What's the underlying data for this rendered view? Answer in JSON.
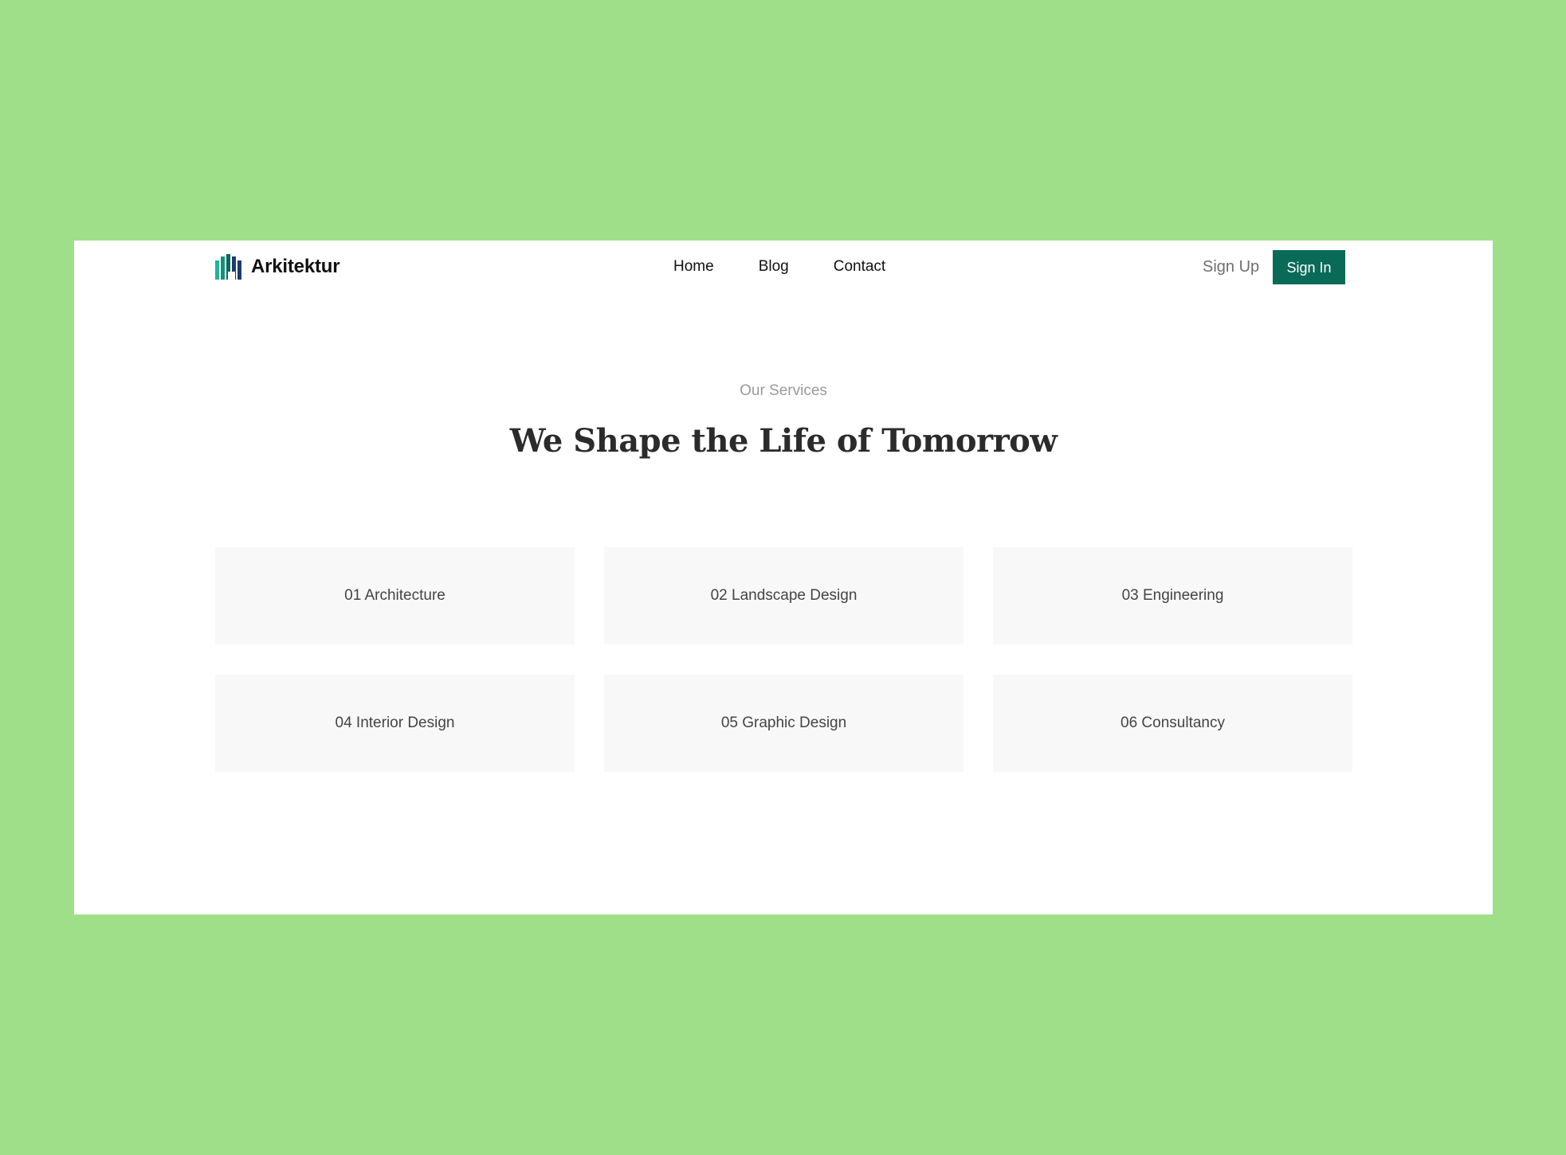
{
  "brand": {
    "name": "Arkitektur",
    "logo_icon": "building-bars-icon",
    "colors": [
      "#1fb59a",
      "#0a6a58",
      "#1b3b6f"
    ]
  },
  "nav": {
    "items": [
      {
        "label": "Home"
      },
      {
        "label": "Blog"
      },
      {
        "label": "Contact"
      }
    ]
  },
  "auth": {
    "sign_up_label": "Sign Up",
    "sign_in_label": "Sign In",
    "accent_color": "#0a6a58"
  },
  "services": {
    "eyebrow": "Our Services",
    "headline": "We Shape the Life of Tomorrow",
    "items": [
      {
        "label": "01 Architecture"
      },
      {
        "label": "02 Landscape Design"
      },
      {
        "label": "03 Engineering"
      },
      {
        "label": "04 Interior Design"
      },
      {
        "label": "05 Graphic Design"
      },
      {
        "label": "06 Consultancy"
      }
    ]
  },
  "page": {
    "background_color": "#9fdf8a",
    "card_color": "#f8f8f8"
  }
}
